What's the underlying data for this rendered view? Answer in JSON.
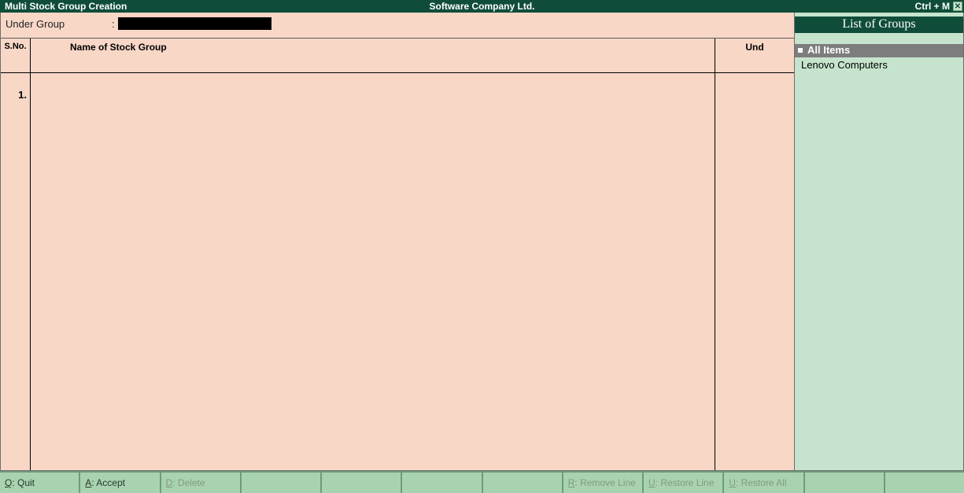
{
  "titlebar": {
    "left": "Multi Stock Group Creation",
    "center": "Software Company Ltd.",
    "shortcut": "Ctrl + M"
  },
  "form": {
    "under_group_label": "Under Group",
    "under_group_value": ""
  },
  "grid": {
    "headers": {
      "sno": "S.No.",
      "name": "Name of Stock Group",
      "under": "Und"
    },
    "rows": [
      {
        "sno": "1."
      }
    ]
  },
  "side": {
    "title": "List of Groups",
    "selected": "All Items",
    "items": [
      "Lenovo Computers"
    ]
  },
  "buttons": {
    "quit": {
      "key": "Q",
      "label": ": Quit",
      "enabled": true
    },
    "accept": {
      "key": "A",
      "label": ": Accept",
      "enabled": true
    },
    "delete": {
      "key": "D",
      "label": ": Delete",
      "enabled": false
    },
    "remove": {
      "key": "R",
      "label": ": Remove Line",
      "enabled": false
    },
    "restoreLine": {
      "key": "U",
      "label": ": Restore Line",
      "enabled": false
    },
    "restoreAll": {
      "key": "U",
      "label": ": Restore All",
      "enabled": false
    }
  }
}
